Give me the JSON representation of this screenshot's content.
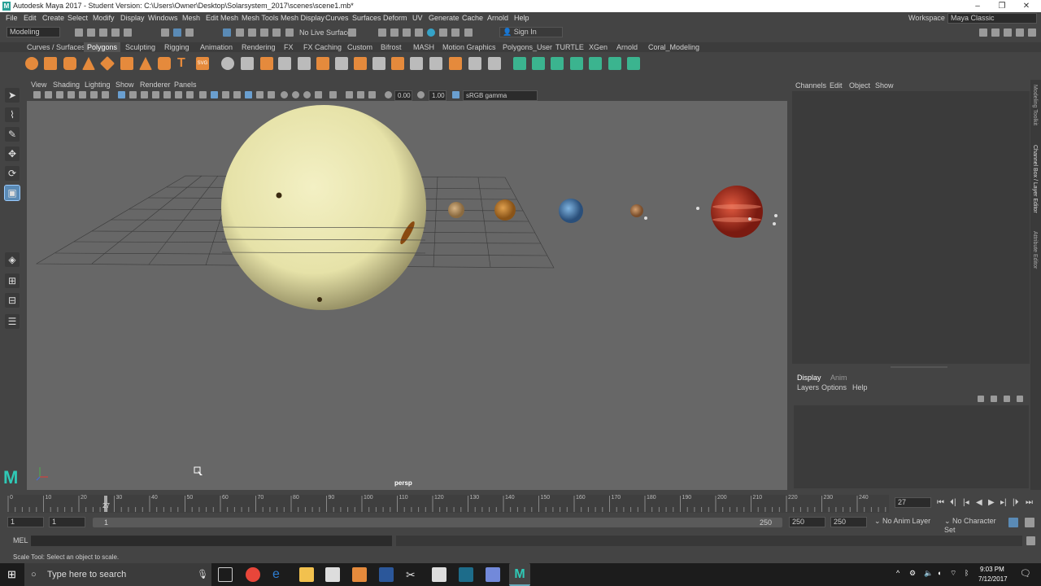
{
  "window": {
    "title": "Autodesk Maya 2017 - Student Version: C:\\Users\\Owner\\Desktop\\Solarsystem_2017\\scenes\\scene1.mb*",
    "logo": "M"
  },
  "menubar": [
    "File",
    "Edit",
    "Create",
    "Select",
    "Modify",
    "Display",
    "Windows",
    "Mesh",
    "Edit Mesh",
    "Mesh Tools",
    "Mesh Display",
    "Curves",
    "Surfaces",
    "Deform",
    "UV",
    "Generate",
    "Cache",
    "Arnold",
    "Help"
  ],
  "workspace": {
    "label": "Workspace :",
    "value": "Maya Classic"
  },
  "statusline": {
    "mode": "Modeling",
    "live_surface": "No Live Surface",
    "sign_in": "Sign In"
  },
  "shelf_tabs": [
    "Curves / Surfaces",
    "Polygons",
    "Sculpting",
    "Rigging",
    "Animation",
    "Rendering",
    "FX",
    "FX Caching",
    "Custom",
    "Bifrost",
    "MASH",
    "Motion Graphics",
    "Polygons_User",
    "TURTLE",
    "XGen",
    "Arnold",
    "Coral_Modeling"
  ],
  "shelf_active": "Polygons",
  "panel_menu": [
    "View",
    "Shading",
    "Lighting",
    "Show",
    "Renderer",
    "Panels"
  ],
  "panel_toolbar": {
    "near": "0.00",
    "far": "1.00",
    "color_space": "sRGB gamma"
  },
  "viewport": {
    "camera": "persp"
  },
  "channel_box": {
    "menu": [
      "Channels",
      "Edit",
      "Object",
      "Show"
    ]
  },
  "layer_editor": {
    "tabs": [
      "Display",
      "Anim"
    ],
    "menu": [
      "Layers",
      "Options",
      "Help"
    ]
  },
  "side_tabs": [
    "Modeling Toolkit",
    "Channel Box / Layer Editor",
    "Attribute Editor"
  ],
  "timeline": {
    "ticks": [
      "0",
      "10",
      "20",
      "30",
      "40",
      "50",
      "60",
      "70",
      "80",
      "90",
      "100",
      "110",
      "120",
      "130",
      "140",
      "150",
      "160",
      "170",
      "180",
      "190",
      "200",
      "210",
      "220",
      "230",
      "240"
    ],
    "current_frame_marker": "27",
    "current_frame": "27"
  },
  "range": {
    "start": "1",
    "anim_start": "1",
    "slider_start": "1",
    "slider_end": "250",
    "end": "250",
    "anim_end": "250",
    "anim_layer": "No Anim Layer",
    "char_set": "No Character Set"
  },
  "command_line": {
    "label": "MEL"
  },
  "help_line": "Scale Tool: Select an object to scale.",
  "taskbar": {
    "search_placeholder": "Type here to search",
    "time": "9:03 PM",
    "date": "7/12/2017"
  }
}
